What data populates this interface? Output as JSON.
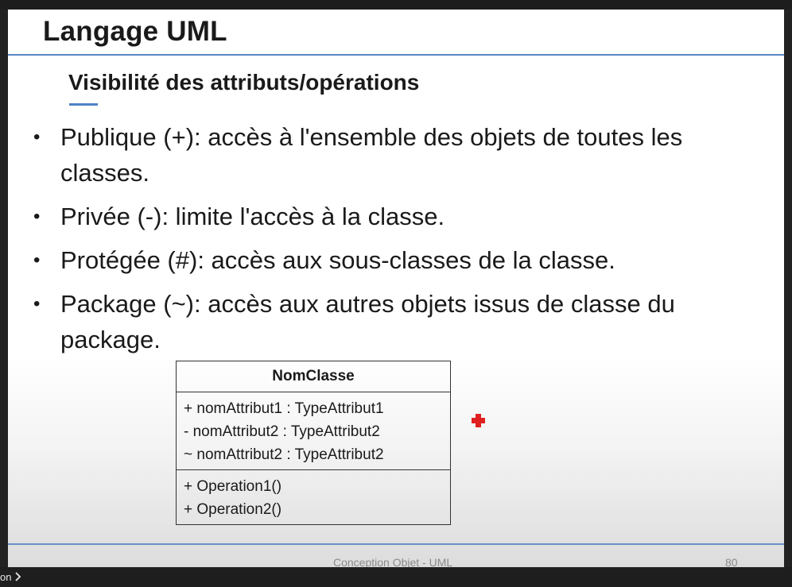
{
  "slide": {
    "title": "Langage UML",
    "subtitle": "Visibilité des attributs/opérations",
    "bullets": [
      "Publique (+): accès à l'ensemble des objets de toutes les classes.",
      "Privée (-): limite l'accès à la classe.",
      "Protégée (#): accès aux sous-classes de la classe.",
      "Package (~): accès aux autres objets issus de classe du package."
    ],
    "bullet_symbol": "•",
    "uml_class": {
      "name": "NomClasse",
      "attributes": [
        "+ nomAttribut1 : TypeAttribut1",
        "- nomAttribut2 : TypeAttribut2",
        "~ nomAttribut2 : TypeAttribut2"
      ],
      "operations": [
        "+ Operation1()",
        "+ Operation2()"
      ]
    },
    "footer": {
      "center_text": "Conception Objet - UML",
      "page_number": "80"
    }
  },
  "player": {
    "corner_label": "on",
    "corner_icon": "chevron-right-icon"
  },
  "colors": {
    "title_rule": "#5b87c4",
    "subtitle_accent": "#4f82c4",
    "pointer": "#e02020"
  },
  "pointer_icon": "red-laser-pointer-icon"
}
